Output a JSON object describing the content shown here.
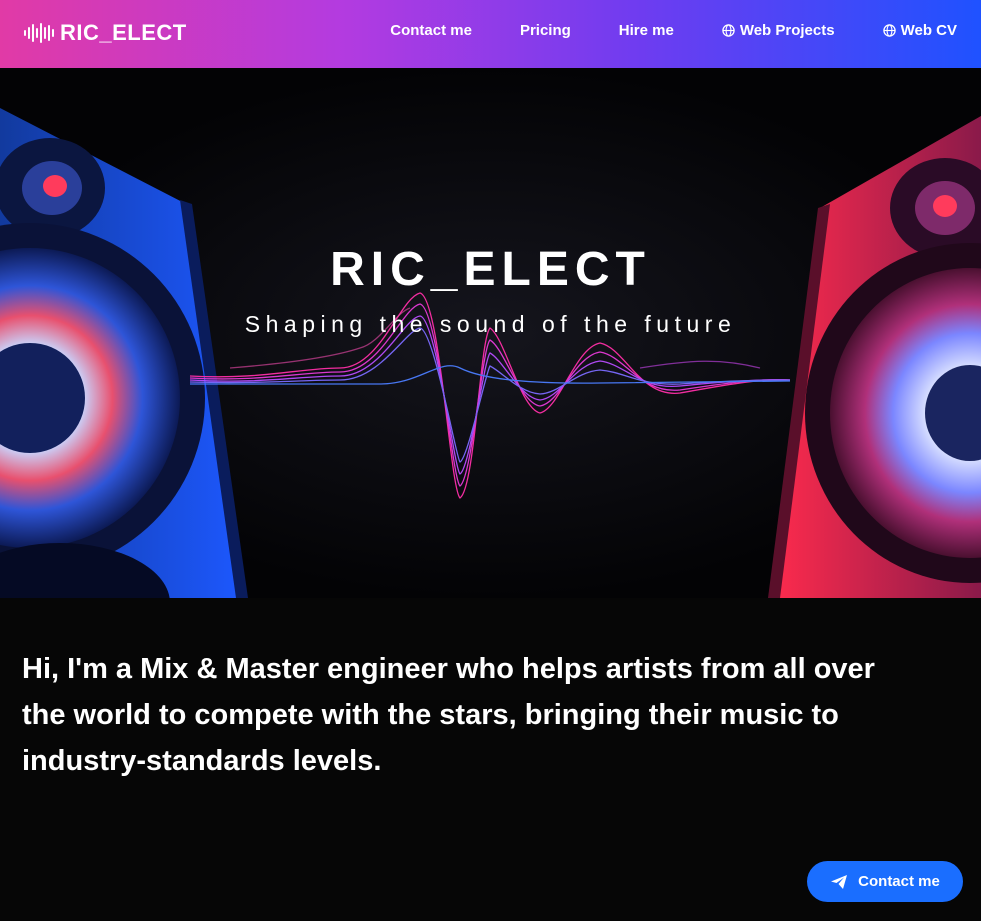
{
  "header": {
    "logo_text": "RIC_ELECT",
    "logo_icon": "sound-wave-icon",
    "nav": [
      {
        "label": "Contact me",
        "icon": null
      },
      {
        "label": "Pricing",
        "icon": null
      },
      {
        "label": "Hire me",
        "icon": null
      },
      {
        "label": "Web Projects",
        "icon": "globe-icon"
      },
      {
        "label": "Web CV",
        "icon": "globe-icon"
      }
    ]
  },
  "hero": {
    "title": "RIC_ELECT",
    "subtitle": "Shaping the sound of the future",
    "image": "speakers-with-sound-wave"
  },
  "intro": {
    "text": "Hi, I'm a Mix & Master engineer who helps artists from all over the world to compete with the stars, bringing their music to industry-standards levels."
  },
  "cta": {
    "label": "Contact me",
    "icon": "send-icon"
  },
  "colors": {
    "header_gradient_start": "#e13aa6",
    "header_gradient_end": "#1f52ff",
    "cta_blue": "#1a6eff",
    "background": "#060606"
  }
}
